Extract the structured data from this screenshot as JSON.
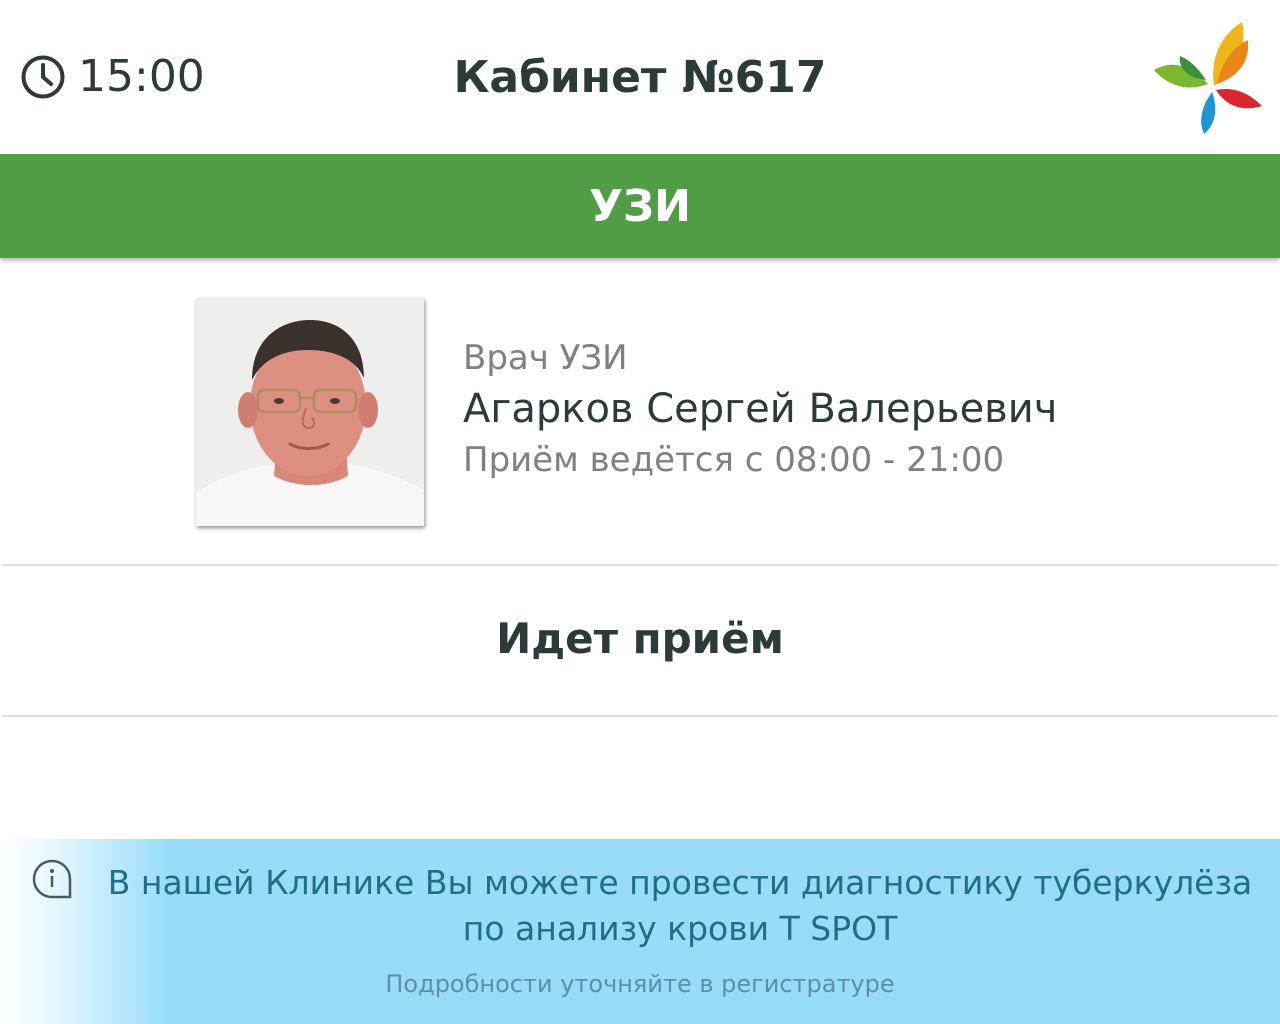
{
  "header": {
    "time": "15:00",
    "cabinet_title": "Кабинет №617",
    "clock_icon": "clock-icon",
    "logo_icon": "butterfly-logo"
  },
  "service": {
    "title": "УЗИ",
    "bar_color": "#509d45"
  },
  "doctor": {
    "role": "Врач УЗИ",
    "name": "Агарков Сергей Валерьевич",
    "hours": "Приём ведётся с 08:00 - 21:00"
  },
  "status": {
    "text": "Идет приём"
  },
  "banner": {
    "info_icon": "info-icon",
    "line1": "В нашей Клинике Вы можете провести диагностику туберкулёза",
    "line2": "по анализу крови T SPOT",
    "note": "Подробности уточняйте в регистратуре",
    "background_color": "#98dcf8",
    "text_color": "#1f6f8a"
  }
}
